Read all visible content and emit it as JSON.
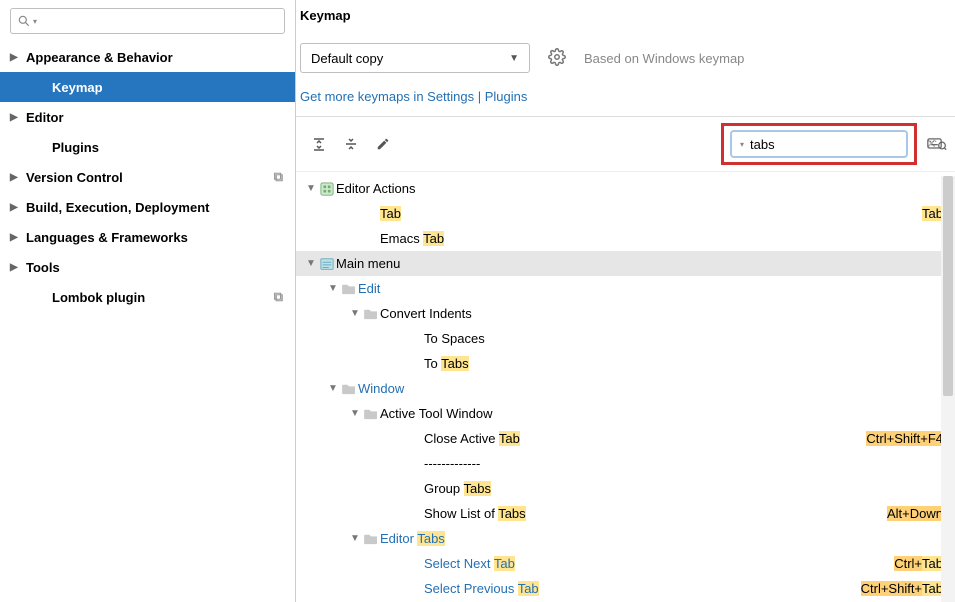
{
  "sidebar": {
    "search_placeholder": "",
    "items": [
      {
        "label": "Appearance & Behavior",
        "expandable": true,
        "indent": 0
      },
      {
        "label": "Keymap",
        "expandable": false,
        "indent": 1,
        "selected": true
      },
      {
        "label": "Editor",
        "expandable": true,
        "indent": 0
      },
      {
        "label": "Plugins",
        "expandable": false,
        "indent": 1
      },
      {
        "label": "Version Control",
        "expandable": true,
        "indent": 0,
        "copy": true
      },
      {
        "label": "Build, Execution, Deployment",
        "expandable": true,
        "indent": 0
      },
      {
        "label": "Languages & Frameworks",
        "expandable": true,
        "indent": 0
      },
      {
        "label": "Tools",
        "expandable": true,
        "indent": 0
      },
      {
        "label": "Lombok plugin",
        "expandable": false,
        "indent": 1,
        "copy": true
      }
    ]
  },
  "header": {
    "title": "Keymap"
  },
  "scheme": {
    "selected": "Default copy",
    "hint": "Based on Windows keymap"
  },
  "links": {
    "more": "Get more keymaps in Settings | Plugins"
  },
  "filter": {
    "value": "tabs"
  },
  "tree": {
    "rows": [
      {
        "depth": 0,
        "icon": "actions",
        "expand": true,
        "parts": [
          {
            "t": "Editor Actions"
          }
        ]
      },
      {
        "depth": 2,
        "parts": [
          {
            "t": "Tab",
            "h": 1
          }
        ],
        "shortcut": [
          {
            "t": "Tab",
            "h": 1
          }
        ]
      },
      {
        "depth": 2,
        "parts": [
          {
            "t": "Emacs "
          },
          {
            "t": "Tab",
            "h": 1
          }
        ]
      },
      {
        "depth": 0,
        "icon": "menu",
        "expand": true,
        "hilite": true,
        "parts": [
          {
            "t": "Main menu"
          }
        ]
      },
      {
        "depth": 1,
        "icon": "folder",
        "expand": true,
        "blue": true,
        "parts": [
          {
            "t": "Edit"
          }
        ]
      },
      {
        "depth": 2,
        "icon": "folder",
        "expand": true,
        "parts": [
          {
            "t": "Convert Indents"
          }
        ]
      },
      {
        "depth": 4,
        "parts": [
          {
            "t": "To Spaces"
          }
        ]
      },
      {
        "depth": 4,
        "parts": [
          {
            "t": "To "
          },
          {
            "t": "Tabs",
            "h": 1
          }
        ]
      },
      {
        "depth": 1,
        "icon": "folder",
        "expand": true,
        "blue": true,
        "parts": [
          {
            "t": "Window"
          }
        ]
      },
      {
        "depth": 2,
        "icon": "folder",
        "expand": true,
        "parts": [
          {
            "t": "Active Tool Window"
          }
        ]
      },
      {
        "depth": 4,
        "parts": [
          {
            "t": "Close Active "
          },
          {
            "t": "Tab",
            "h": 1
          }
        ],
        "shortcut": [
          {
            "t": "Ctrl+Shift+F4",
            "h": 2
          }
        ]
      },
      {
        "depth": 4,
        "parts": [
          {
            "t": "-------------"
          }
        ]
      },
      {
        "depth": 4,
        "parts": [
          {
            "t": "Group "
          },
          {
            "t": "Tabs",
            "h": 1
          }
        ]
      },
      {
        "depth": 4,
        "parts": [
          {
            "t": "Show List of "
          },
          {
            "t": "Tabs",
            "h": 1
          }
        ],
        "shortcut": [
          {
            "t": "Alt+Down",
            "h": 2
          }
        ]
      },
      {
        "depth": 2,
        "icon": "folder",
        "expand": true,
        "blue": true,
        "parts": [
          {
            "t": "Editor "
          },
          {
            "t": "Tabs",
            "h": 1
          }
        ]
      },
      {
        "depth": 4,
        "blue": true,
        "parts": [
          {
            "t": "Select Next "
          },
          {
            "t": "Tab",
            "h": 1
          }
        ],
        "shortcut": [
          {
            "t": "Ctrl+",
            "h": 2
          },
          {
            "t": "Tab",
            "h": 1
          }
        ]
      },
      {
        "depth": 4,
        "blue": true,
        "parts": [
          {
            "t": "Select Previous "
          },
          {
            "t": "Tab",
            "h": 1
          }
        ],
        "shortcut": [
          {
            "t": "Ctrl+Shift+",
            "h": 2
          },
          {
            "t": "Tab",
            "h": 1
          }
        ]
      }
    ]
  }
}
